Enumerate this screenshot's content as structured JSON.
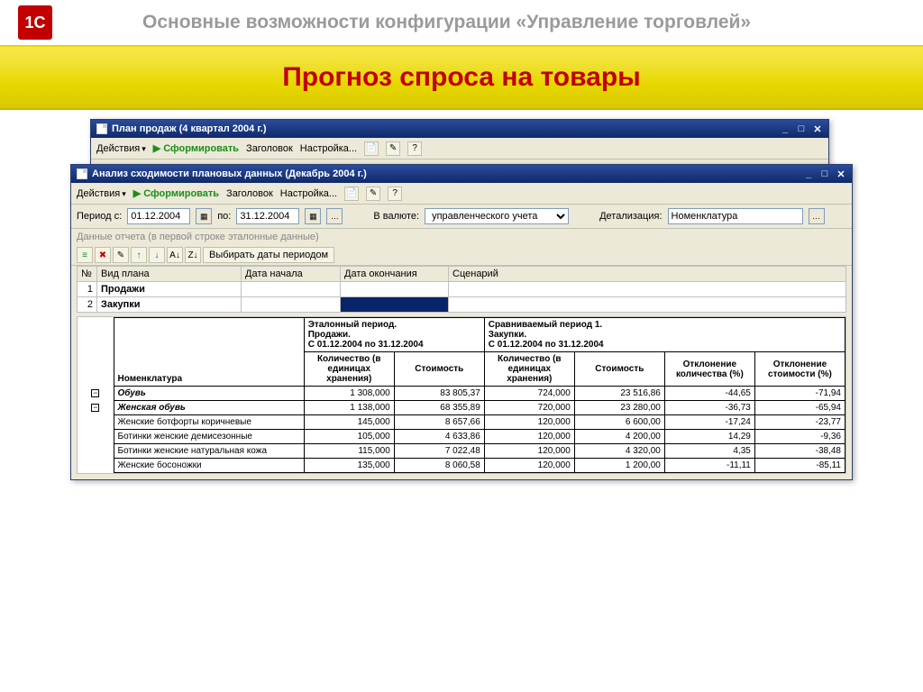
{
  "slide": {
    "logo": "1C",
    "subtitle": "Основные возможности конфигурации «Управление торговлей»",
    "title": "Прогноз спроса на товары"
  },
  "back_window": {
    "title": "План продаж (4 квартал 2004 г.)",
    "toolbar": {
      "actions": "Действия",
      "run": "Сформировать",
      "header": "Заголовок",
      "settings": "Настройка..."
    }
  },
  "front_window": {
    "title": "Анализ сходимости плановых данных (Декабрь 2004 г.)",
    "toolbar": {
      "actions": "Действия",
      "run": "Сформировать",
      "header": "Заголовок",
      "settings": "Настройка..."
    },
    "filters": {
      "period_from_lbl": "Период с:",
      "period_from": "01.12.2004",
      "period_to_lbl": "по:",
      "period_to": "31.12.2004",
      "currency_lbl": "В валюте:",
      "currency": "управленческого учета",
      "detail_lbl": "Детализация:",
      "detail": "Номенклатура"
    },
    "section_label": "Данные отчета (в первой строке эталонные данные)",
    "mini_tb_text": "Выбирать даты периодом",
    "plan_grid": {
      "cols": {
        "num": "№",
        "type": "Вид плана",
        "start": "Дата начала",
        "end": "Дата окончания",
        "scenario": "Сценарий"
      },
      "rows": [
        {
          "n": "1",
          "type": "Продажи",
          "start": "",
          "end": "",
          "scenario": ""
        },
        {
          "n": "2",
          "type": "Закупки",
          "start": "",
          "end": "",
          "scenario": ""
        }
      ]
    },
    "report": {
      "head": {
        "nomen": "Номенклатура",
        "ref_period": "Эталонный период.\nПродажи.\nС 01.12.2004 по 31.12.2004",
        "cmp_period": "Сравниваемый период 1.\nЗакупки.\nС 01.12.2004 по 31.12.2004",
        "qty": "Количество (в единицах хранения)",
        "cost": "Стоимость",
        "dev_qty": "Отклонение количества (%)",
        "dev_cost": "Отклонение стоимости (%)"
      },
      "rows": [
        {
          "tree": "−",
          "name": "Обувь",
          "bold": true,
          "q1": "1 308,000",
          "c1": "83 805,37",
          "q2": "724,000",
          "c2": "23 516,86",
          "dq": "-44,65",
          "dc": "-71,94"
        },
        {
          "tree": "−",
          "name": "Женская обувь",
          "bold": true,
          "q1": "1 138,000",
          "c1": "68 355,89",
          "q2": "720,000",
          "c2": "23 280,00",
          "dq": "-36,73",
          "dc": "-65,94"
        },
        {
          "tree": "",
          "name": "Женские ботфорты коричневые",
          "bold": false,
          "q1": "145,000",
          "c1": "8 657,66",
          "q2": "120,000",
          "c2": "6 600,00",
          "dq": "-17,24",
          "dc": "-23,77"
        },
        {
          "tree": "",
          "name": "Ботинки женские демисезонные",
          "bold": false,
          "q1": "105,000",
          "c1": "4 633,86",
          "q2": "120,000",
          "c2": "4 200,00",
          "dq": "14,29",
          "dc": "-9,36"
        },
        {
          "tree": "",
          "name": "Ботинки женские натуральная кожа",
          "bold": false,
          "q1": "115,000",
          "c1": "7 022,48",
          "q2": "120,000",
          "c2": "4 320,00",
          "dq": "4,35",
          "dc": "-38,48"
        },
        {
          "tree": "",
          "name": "Женские босоножки",
          "bold": false,
          "q1": "135,000",
          "c1": "8 060,58",
          "q2": "120,000",
          "c2": "1 200,00",
          "dq": "-11,11",
          "dc": "-85,11"
        }
      ]
    }
  }
}
